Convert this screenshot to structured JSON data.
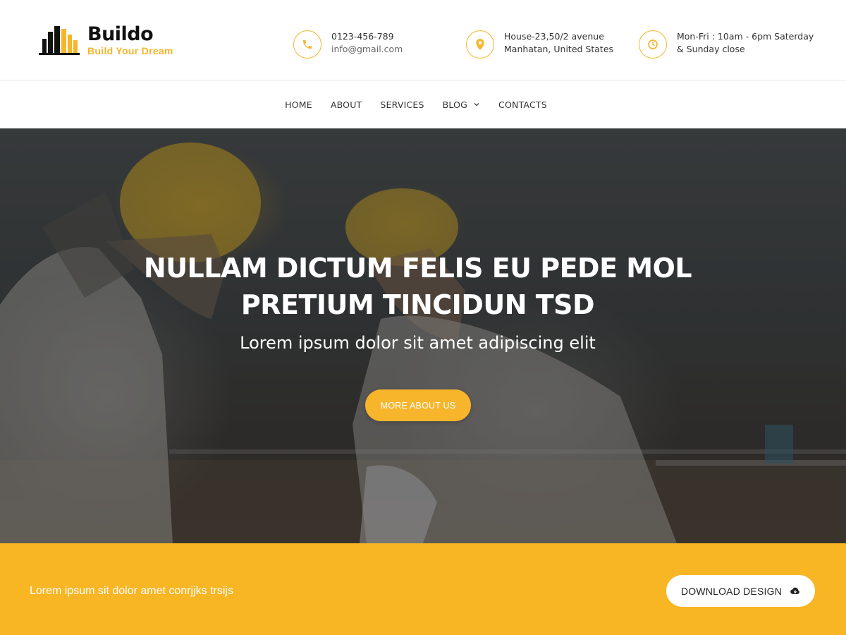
{
  "brand": {
    "name": "Buildo",
    "tagline": "Build Your Dream",
    "accent_color": "#f7b52b"
  },
  "contact_info": [
    {
      "icon": "phone-icon",
      "line1": "0123-456-789",
      "line2": "info@gmail.com"
    },
    {
      "icon": "map-pin-icon",
      "line1": "House-23,50/2 avenue",
      "line2": "Manhatan, United States"
    },
    {
      "icon": "clock-icon",
      "line1": "Mon-Fri : 10am - 6pm Saterday",
      "line2": "& Sunday close"
    }
  ],
  "nav": {
    "items": [
      {
        "label": "HOME"
      },
      {
        "label": "ABOUT"
      },
      {
        "label": "SERVICES"
      },
      {
        "label": "BLOG",
        "has_dropdown": true
      },
      {
        "label": "CONTACTS"
      }
    ]
  },
  "hero": {
    "title_line1": "NULLAM DICTUM FELIS EU PEDE MOL",
    "title_line2": "PRETIUM TINCIDUN TSD",
    "subtitle": "Lorem ipsum dolor sit amet adipiscing elit",
    "button_label": "MORE ABOUT US"
  },
  "cta": {
    "text": "Lorem ipsum sit dolor amet conrjjks trsijs",
    "button_label": "DOWNLOAD DESIGN",
    "button_icon": "cloud-download-icon",
    "background_color": "#f8b524"
  }
}
